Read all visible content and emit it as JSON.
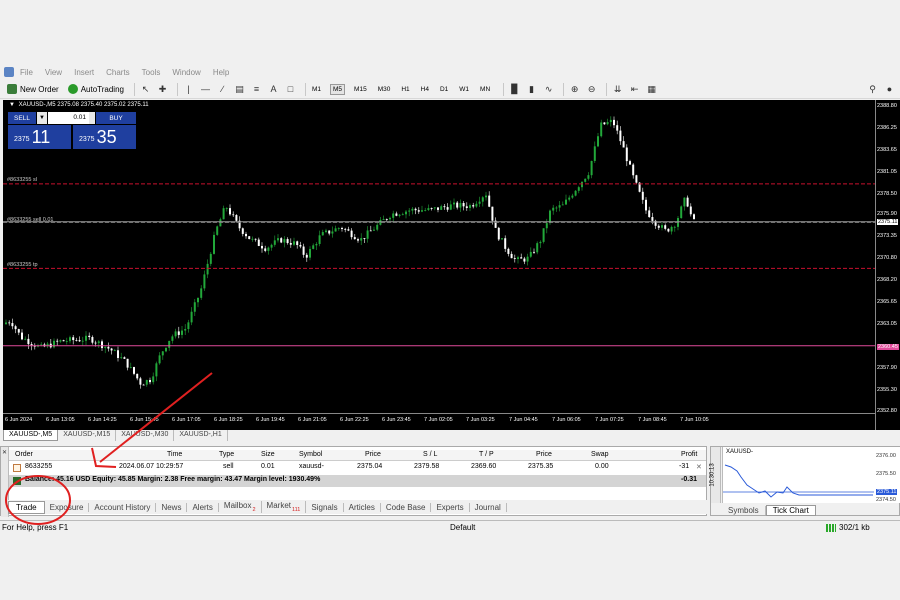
{
  "menu": [
    "File",
    "View",
    "Insert",
    "Charts",
    "Tools",
    "Window",
    "Help"
  ],
  "toolbar": {
    "new_order": "New Order",
    "autotrading": "AutoTrading",
    "timeframes": [
      "M1",
      "M5",
      "M15",
      "M30",
      "H1",
      "H4",
      "D1",
      "W1",
      "MN"
    ],
    "active_timeframe": "M5"
  },
  "chart": {
    "title": "XAUUSD-,M5  2375.08 2375.40 2375.02 2375.11",
    "one_click": {
      "sell_label": "SELL",
      "buy_label": "BUY",
      "volume": "0.01",
      "sell_small": "2375",
      "sell_big": "11",
      "buy_small": "2375",
      "buy_big": "35"
    },
    "level_labels": {
      "sl": "#8633255 sl",
      "order": "#8633255 sell 0.01",
      "tp": "#8633255 tp"
    },
    "price_labels": [
      "2388.80",
      "2386.25",
      "2383.65",
      "2381.05",
      "2378.50",
      "2375.90",
      "2375.11",
      "2373.35",
      "2370.80",
      "2368.20",
      "2365.65",
      "2363.05",
      "2360.45",
      "2357.90",
      "2355.30",
      "2352.80"
    ],
    "time_labels": [
      "6 Jun 2024",
      "6 Jun 13:05",
      "6 Jun 14:25",
      "6 Jun 15:45",
      "6 Jun 17:05",
      "6 Jun 18:25",
      "6 Jun 19:45",
      "6 Jun 21:05",
      "6 Jun 22:25",
      "6 Jun 23:45",
      "7 Jun 02:05",
      "7 Jun 03:25",
      "7 Jun 04:45",
      "7 Jun 06:05",
      "7 Jun 07:25",
      "7 Jun 08:45",
      "7 Jun 10:05"
    ],
    "tabs": [
      "XAUUSD-,M5",
      "XAUUSD-,M15",
      "XAUUSD-,M30",
      "XAUUSD-,H1"
    ]
  },
  "terminal": {
    "columns": [
      "Order",
      "Time",
      "Type",
      "Size",
      "Symbol",
      "Price",
      "S / L",
      "T / P",
      "Price",
      "Swap",
      "Profit"
    ],
    "row": {
      "order": "8633255",
      "time": "2024.06.07 10:29:57",
      "type": "sell",
      "size": "0.01",
      "symbol": "xauusd-",
      "price": "2375.04",
      "sl": "2379.58",
      "tp": "2369.60",
      "cur_price": "2375.35",
      "swap": "0.00",
      "profit": "-31"
    },
    "balance_text": "Balance: 45.16 USD  Equity: 45.85  Margin: 2.38  Free margin: 43.47  Margin level: 1930.49%",
    "balance_profit": "-0.31",
    "tabs": [
      {
        "label": "Trade",
        "badge": ""
      },
      {
        "label": "Exposure",
        "badge": ""
      },
      {
        "label": "Account History",
        "badge": ""
      },
      {
        "label": "News",
        "badge": ""
      },
      {
        "label": "Alerts",
        "badge": ""
      },
      {
        "label": "Mailbox",
        "badge": "2"
      },
      {
        "label": "Market",
        "badge": "111"
      },
      {
        "label": "Signals",
        "badge": ""
      },
      {
        "label": "Articles",
        "badge": ""
      },
      {
        "label": "Code Base",
        "badge": ""
      },
      {
        "label": "Experts",
        "badge": ""
      },
      {
        "label": "Journal",
        "badge": ""
      }
    ]
  },
  "tick_chart": {
    "title": "XAUUSD-",
    "time": "10:30:13",
    "prices": [
      "2376.00",
      "2375.50",
      "2375.11",
      "2374.50"
    ],
    "tabs": [
      "Symbols",
      "Tick Chart"
    ]
  },
  "status": {
    "help": "For Help, press F1",
    "profile": "Default",
    "connection": "302/1 kb"
  },
  "colors": {
    "chart_bg": "#000000",
    "bull": "#22a83a",
    "bear": "#ffffff",
    "sl_tp_line": "#c8102e",
    "bid_line": "#9a9a9a",
    "ask_line": "#e04a9a",
    "one_click": "#1f3f9f",
    "annotation": "#e02020"
  }
}
